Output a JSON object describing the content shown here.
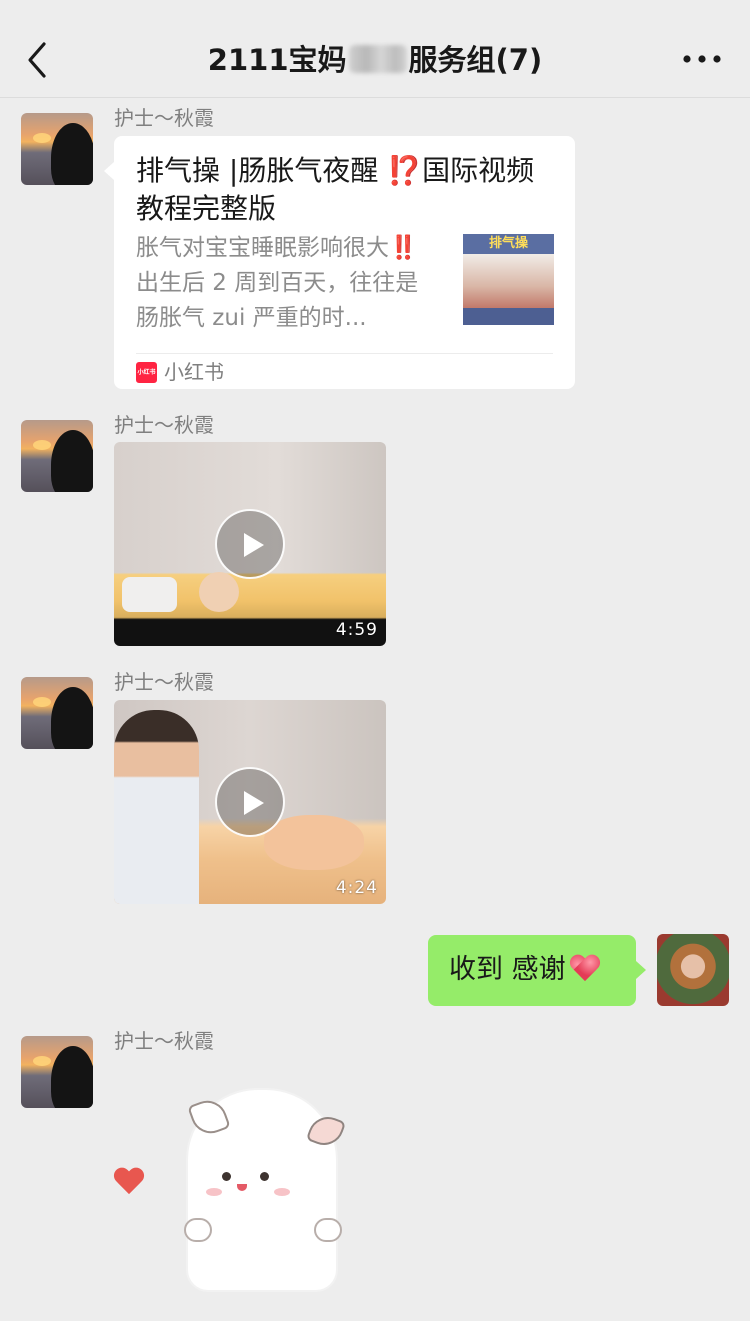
{
  "header": {
    "title_prefix": "2111宝妈",
    "title_suffix": "服务组(7)",
    "back_icon": "chevron-left-icon",
    "more_icon": "more-horizontal-icon"
  },
  "messages": [
    {
      "type": "link",
      "sender": "护士～秋霞",
      "title": "排气操 |肠胀气夜醒 ⁉️国际视频教程完整版",
      "description": "胀气对宝宝睡眠影响很大‼️ 出生后 2 周到百天，往往是肠胀气 zui 严重的时...",
      "thumbnail_text": "排气操",
      "source_icon_text": "小红书",
      "source": "小红书"
    },
    {
      "type": "video",
      "sender": "护士～秋霞",
      "duration": "4:59"
    },
    {
      "type": "video",
      "sender": "护士～秋霞",
      "duration": "4:24"
    },
    {
      "type": "text",
      "sender": "self",
      "text": "收到 感谢"
    },
    {
      "type": "sticker",
      "sender": "护士～秋霞"
    }
  ],
  "colors": {
    "background": "#ededed",
    "self_bubble": "#95ec69",
    "other_bubble": "#ffffff",
    "source_brand": "#ff2442"
  }
}
